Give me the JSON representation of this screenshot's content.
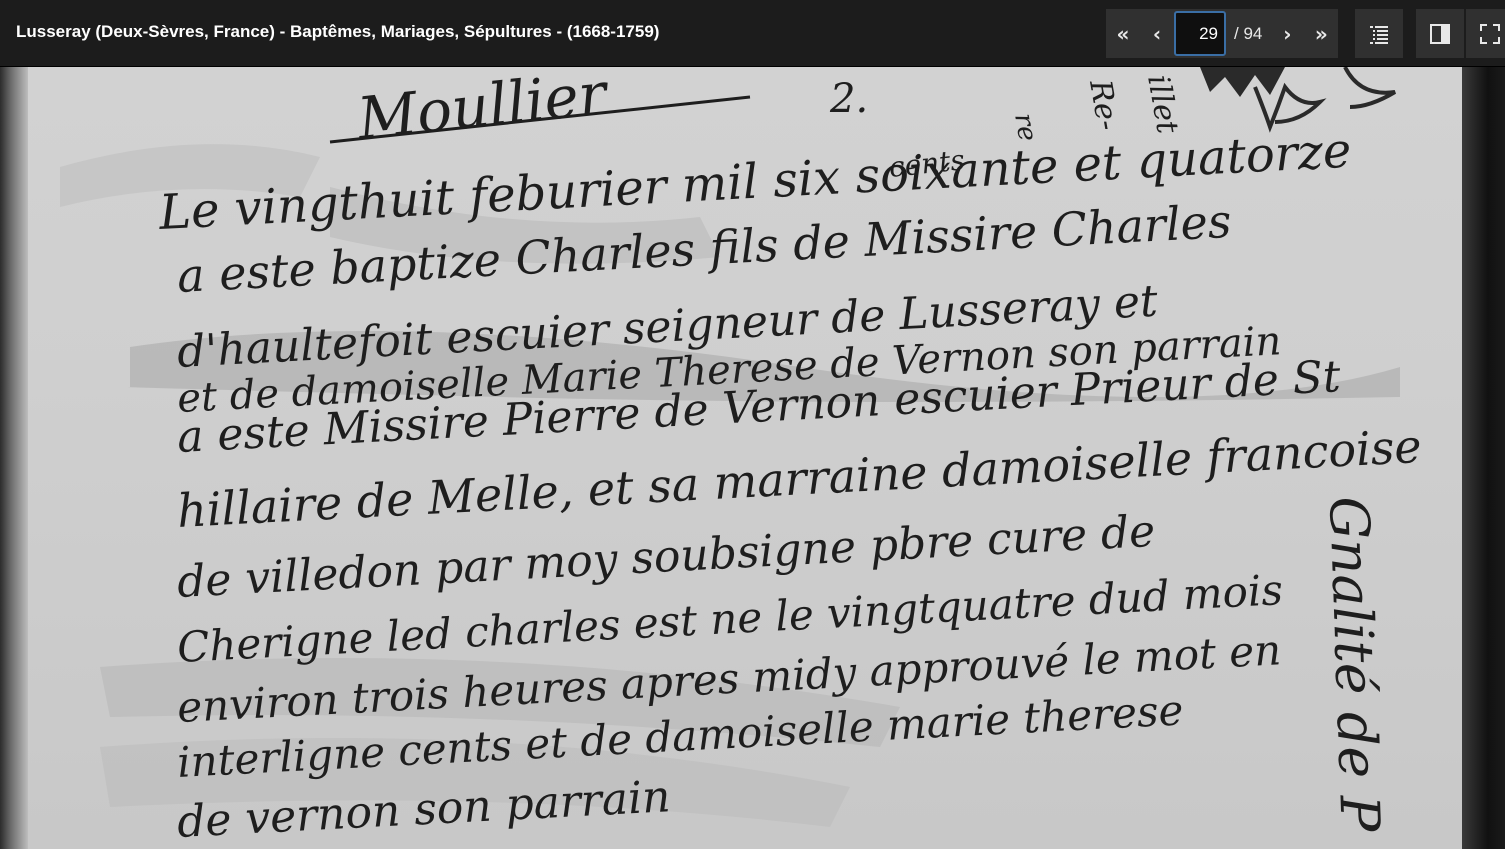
{
  "window": {
    "title": "Lusseray (Deux-Sèvres, France) - Baptêmes, Mariages, Sépultures - (1668-1759)"
  },
  "pager": {
    "first_label": "«",
    "prev_label": "‹",
    "current_page": "29",
    "total_label": "/ 94",
    "next_label": "›",
    "last_label": "»"
  },
  "toolbar": {
    "icons": [
      "list-icon",
      "side-panel-icon",
      "fullscreen-icon"
    ]
  },
  "document": {
    "margin_heading": "Moullier",
    "lines": [
      "Le vingthuit feburier mil six soixante et quatorze",
      "a este baptize Charles fils de Missire Charles",
      "d'haultefoit escuier seigneur de Lusseray et",
      "et de damoiselle Marie Therese de Vernon son parrain",
      "a este Missire Pierre de Vernon escuier Prieur de St",
      "hillaire de Melle, et sa marraine damoiselle francoise",
      "de villedon par moy soubsigne pbre cure de",
      "Cherigne led charles est ne le vingtquatre dud mois",
      "environ trois heures apres midy approuvé le mot en",
      "interligne cents et de damoiselle marie therese",
      "de vernon son parrain"
    ],
    "top_fragments": [
      "re",
      "Re-",
      "illet"
    ],
    "side_note": "Gnalité de P",
    "superscript": "cents",
    "number_mark": "2."
  }
}
